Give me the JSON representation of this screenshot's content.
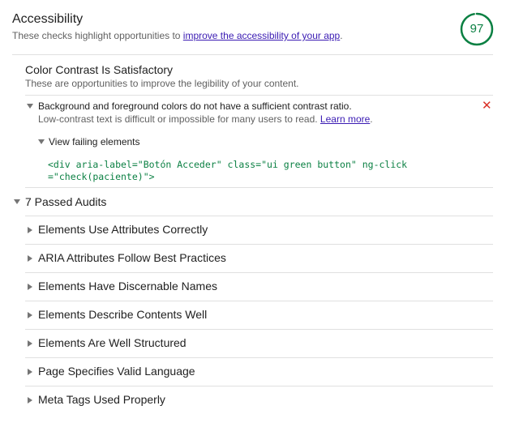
{
  "category": {
    "title": "Accessibility",
    "description_prefix": "These checks highlight opportunities to ",
    "description_link": "improve the accessibility of your app",
    "description_suffix": ".",
    "score": "97",
    "score_fraction": 0.97,
    "score_color": "#0b8043"
  },
  "group": {
    "title": "Color Contrast Is Satisfactory",
    "description": "These are opportunities to improve the legibility of your content."
  },
  "failing_audit": {
    "title": "Background and foreground colors do not have a sufficient contrast ratio.",
    "help_text": "Low-contrast text is difficult or impossible for many users to read. ",
    "learn_more": "Learn more",
    "help_suffix": ".",
    "fail_mark": "✕",
    "fail_color": "#da3127",
    "view_failing_label": "View failing elements",
    "failing_snippet": "<div aria-label=\"Botón Acceder\" class=\"ui green button\" ng-click=\"check(paciente)\">"
  },
  "passed": {
    "title": "7 Passed Audits",
    "audits": [
      "Elements Use Attributes Correctly",
      "ARIA Attributes Follow Best Practices",
      "Elements Have Discernable Names",
      "Elements Describe Contents Well",
      "Elements Are Well Structured",
      "Page Specifies Valid Language",
      "Meta Tags Used Properly"
    ]
  }
}
